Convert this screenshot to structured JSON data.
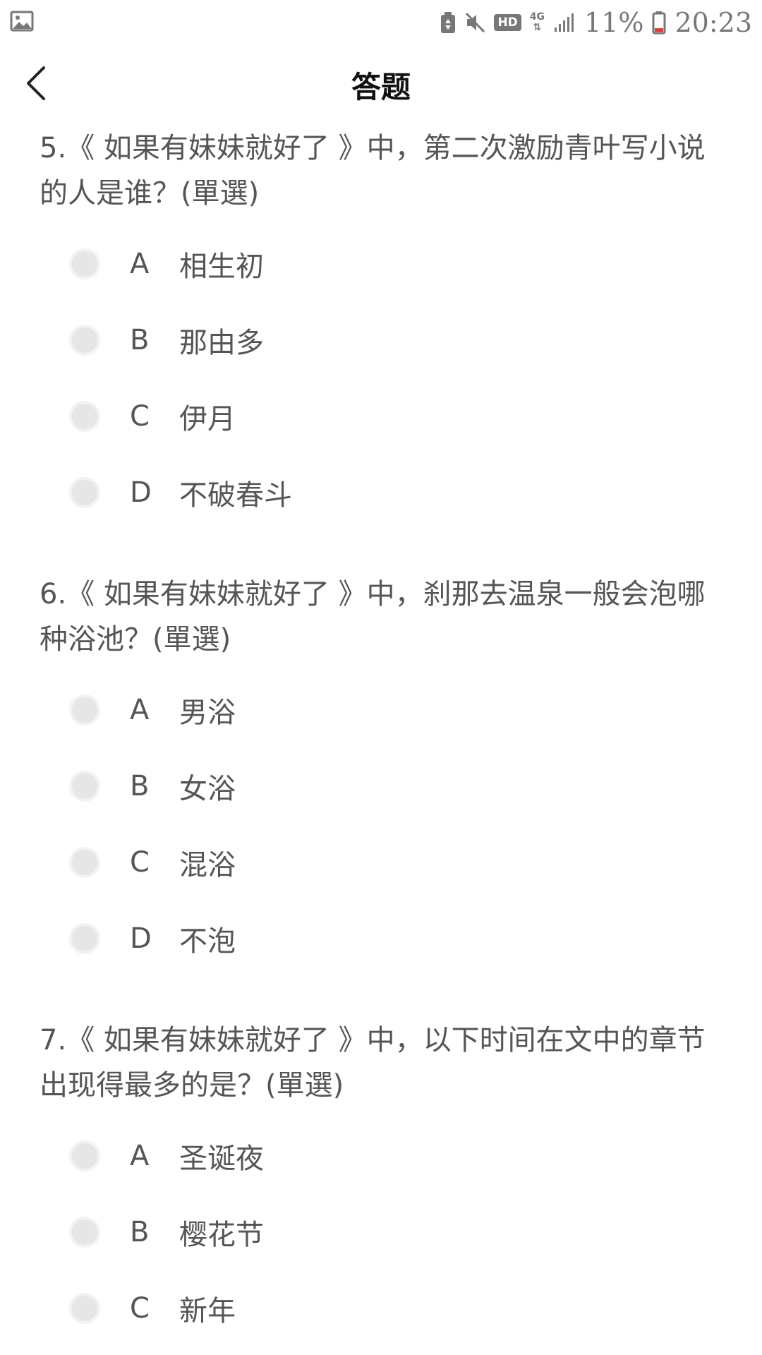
{
  "status_bar": {
    "network": "4G",
    "hd_badge": "HD",
    "battery_percent": "11%",
    "time": "20:23",
    "icons": [
      "gallery-icon",
      "recycle-icon",
      "mute-icon",
      "hd-icon",
      "data-arrows-icon",
      "signal-icon",
      "battery-icon"
    ]
  },
  "header": {
    "title": "答题",
    "back_icon": "chevron-left-icon"
  },
  "questions": [
    {
      "text": "5.《 如果有妹妹就好了 》中，第二次激励青叶写小说的人是谁？(單選)",
      "options": [
        {
          "letter": "A",
          "text": "相生初"
        },
        {
          "letter": "B",
          "text": "那由多"
        },
        {
          "letter": "C",
          "text": "伊月"
        },
        {
          "letter": "D",
          "text": "不破春斗"
        }
      ]
    },
    {
      "text": "6.《 如果有妹妹就好了 》中，刹那去温泉一般会泡哪种浴池？(單選)",
      "options": [
        {
          "letter": "A",
          "text": "男浴"
        },
        {
          "letter": "B",
          "text": "女浴"
        },
        {
          "letter": "C",
          "text": "混浴"
        },
        {
          "letter": "D",
          "text": "不泡"
        }
      ]
    },
    {
      "text": "7.《 如果有妹妹就好了 》中，以下时间在文中的章节出现得最多的是？(單選)",
      "options": [
        {
          "letter": "A",
          "text": "圣诞夜"
        },
        {
          "letter": "B",
          "text": "樱花节"
        },
        {
          "letter": "C",
          "text": "新年"
        }
      ]
    }
  ]
}
